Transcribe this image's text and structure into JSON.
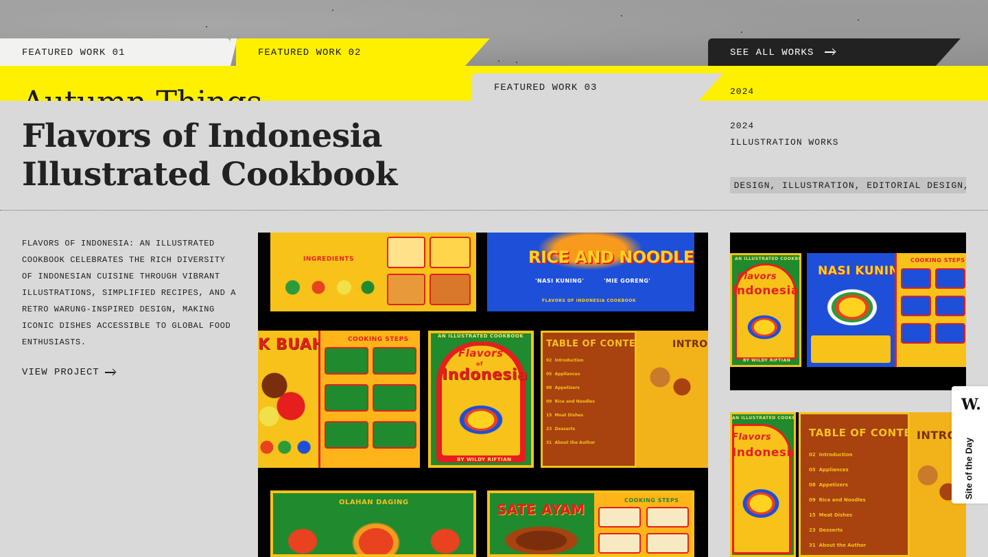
{
  "tabs": {
    "featured_01": "FEATURED WORK 01",
    "featured_02": "FEATURED WORK 02",
    "featured_03": "FEATURED WORK 03",
    "see_all": "SEE ALL WORKS"
  },
  "work_02": {
    "title": "Autumn Things",
    "year": "2024"
  },
  "work_03": {
    "title": "Flavors of Indonesia Illustrated Cookbook",
    "year": "2024",
    "category": "ILLUSTRATION WORKS",
    "tags": "K DESIGN, ILLUSTRATION, EDITORIAL DESIGN, BOOK DESIGN",
    "description": "FLAVORS OF INDONESIA: AN ILLUSTRATED COOKBOOK CELEBRATES THE RICH DIVERSITY OF INDONESIAN CUISINE THROUGH VIBRANT ILLUSTRATIONS, SIMPLIFIED RECIPES, AND A RETRO WARUNG-INSPIRED DESIGN, MAKING ICONIC DISHES ACCESSIBLE TO GLOBAL FOOD ENTHUSIASTS.",
    "view_label": "VIEW PROJECT"
  },
  "artwork": {
    "rice_noodles": "RICE AND NOODLES",
    "nasi_kuning": "'NASI KUNING'",
    "mie_goreng": "'MIE GORENG'",
    "footer_small": "FLAVORS OF INDONESIA COOKBOOK",
    "buah": "K BUAH",
    "cooking_steps": "COOKING STEPS",
    "illustrated": "AN ILLUSTRATED COOKBOOK",
    "flavors": "Flavors",
    "of": "of",
    "indonesia": "Indonesia",
    "by": "BY WILDY RIFTIAN",
    "toc": "TABLE OF CONTENTS",
    "toc_items": [
      "Introduction",
      "Appliances",
      "Appetizers",
      "Rice and Noodles",
      "Meat Dishes",
      "Desserts",
      "About the Author"
    ],
    "toc_pages": [
      "02",
      "05",
      "08",
      "09",
      "15",
      "23",
      "31"
    ],
    "intro": "INTRODUCTION",
    "ingredients": "INGREDIENTS",
    "olahan": "OLAHAN DAGING",
    "sate": "SATE AYAM",
    "nasi_kuning_big": "NASI KUNING"
  },
  "badge": {
    "logo": "W.",
    "label": "Site of the Day"
  },
  "colors": {
    "yellow": "#fff000",
    "panel_grey": "#d9d9d9",
    "dark": "#222222",
    "art_red": "#e61e1e",
    "art_green": "#1f8a2e",
    "art_blue": "#1e4fd8",
    "art_brown": "#7a2f0c"
  }
}
